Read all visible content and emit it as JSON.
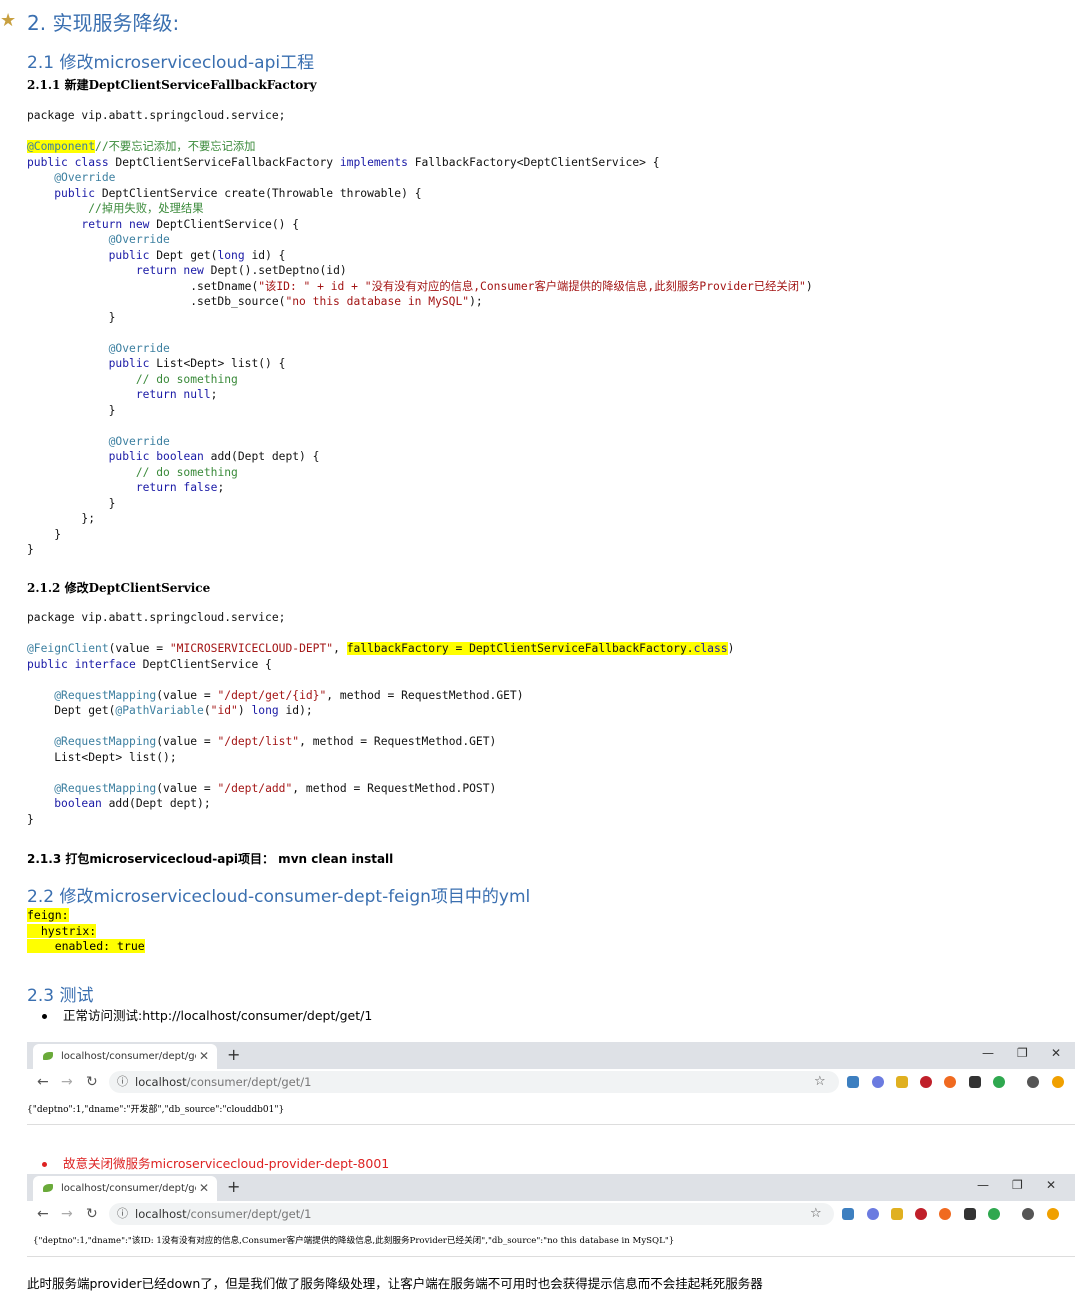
{
  "title": "2. 实现服务降级:",
  "sec21": "2.1 修改microservicecloud-api工程",
  "sec211": "2.1.1 新建DeptClientServiceFallbackFactory",
  "sec212": "2.1.2 修改DeptClientService",
  "sec213": "2.1.3 打包microservicecloud-api项目： mvn clean install",
  "sec22": "2.2 修改microservicecloud-consumer-dept-feign项目中的yml",
  "sec23": "2.3 测试",
  "code1": {
    "package": "package vip.abatt.springcloud.service;",
    "comment_add": "//不要忘记添加，不要忘记添加",
    "comment_call": "//掉用失败，处理结果",
    "dname_str": "\"该ID: \" + id + \"没有没有对应的信息,Consumer客户端提供的降级信息,此刻服务Provider已经关闭\"",
    "dbsource_str": "\"no this database in MySQL\""
  },
  "code2": {
    "package": "package vip.abatt.springcloud.service;"
  },
  "yml": [
    "feign:",
    "  hystrix:",
    "    enabled: true"
  ],
  "bullet1": "正常访问测试:http://localhost/consumer/dept/get/1",
  "bullet2": "故意关闭微服务microservicecloud-provider-dept-8001",
  "browser1": {
    "tab_title": "localhost/consumer/dept/get/",
    "url_host": "localhost",
    "url_path": "/consumer/dept/get/1",
    "response": "{\"deptno\":1,\"dname\":\"开发部\",\"db_source\":\"clouddb01\"}"
  },
  "browser2": {
    "tab_title": "localhost/consumer/dept/get/",
    "url_host": "localhost",
    "url_path": "/consumer/dept/get/1",
    "response": "{\"deptno\":1,\"dname\":\"该ID: 1没有没有对应的信息,Consumer客户端提供的降级信息,此刻服务Provider已经关闭\",\"db_source\":\"no this database in MySQL\"}"
  },
  "footer": "此时服务端provider已经down了，但是我们做了服务降级处理，让客户端在服务端不可用时也会获得提示信息而不会挂起耗死服务器",
  "icons": {
    "star": "star-icon",
    "close": "close-icon",
    "new_tab": "plus-icon",
    "back": "arrow-left-icon",
    "forward": "arrow-right-icon",
    "reload": "reload-icon",
    "info": "info-icon",
    "bookmark": "star-outline-icon"
  },
  "colors": {
    "heading": "#3a6fb0",
    "highlight": "#ffff00",
    "red_bullet": "#dd2222"
  }
}
